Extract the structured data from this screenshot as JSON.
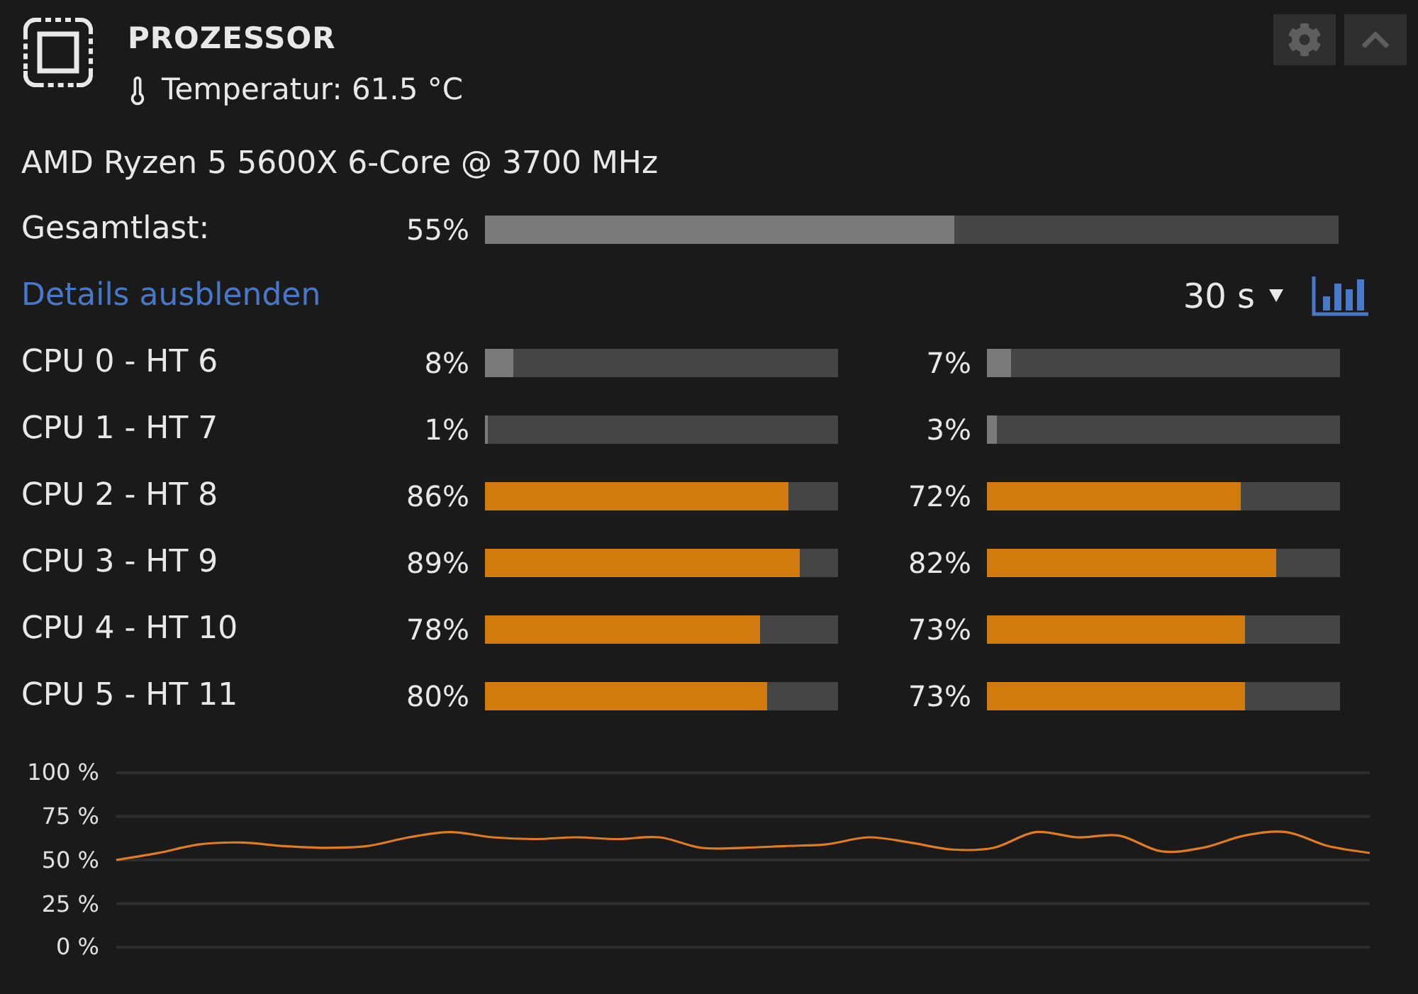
{
  "header": {
    "title": "PROZESSOR",
    "temperature": "Temperatur: 61.5 °C"
  },
  "cpu_name": "AMD Ryzen 5 5600X 6-Core @ 3700 MHz",
  "total_load": {
    "label": "Gesamtlast:",
    "reading": "55%",
    "level": 0.55,
    "color": "#7a7a7a"
  },
  "details_link": "Details ausblenden",
  "interval": {
    "value": "30 s"
  },
  "cores": [
    {
      "label": "CPU 0 - HT 6",
      "threads": [
        {
          "reading": "8%",
          "level": 0.08,
          "color": "#7a7a7a"
        },
        {
          "reading": "7%",
          "level": 0.07,
          "color": "#7a7a7a"
        }
      ]
    },
    {
      "label": "CPU 1 - HT 7",
      "threads": [
        {
          "reading": "1%",
          "level": 0.01,
          "color": "#7a7a7a"
        },
        {
          "reading": "3%",
          "level": 0.03,
          "color": "#7a7a7a"
        }
      ]
    },
    {
      "label": "CPU 2 - HT 8",
      "threads": [
        {
          "reading": "86%",
          "level": 0.86,
          "color": "#d17b0f"
        },
        {
          "reading": "72%",
          "level": 0.72,
          "color": "#d17b0f"
        }
      ]
    },
    {
      "label": "CPU 3 - HT 9",
      "threads": [
        {
          "reading": "89%",
          "level": 0.89,
          "color": "#d17b0f"
        },
        {
          "reading": "82%",
          "level": 0.82,
          "color": "#d17b0f"
        }
      ]
    },
    {
      "label": "CPU 4 - HT 10",
      "threads": [
        {
          "reading": "78%",
          "level": 0.78,
          "color": "#d17b0f"
        },
        {
          "reading": "73%",
          "level": 0.73,
          "color": "#d17b0f"
        }
      ]
    },
    {
      "label": "CPU 5 - HT 11",
      "threads": [
        {
          "reading": "80%",
          "level": 0.8,
          "color": "#d17b0f"
        },
        {
          "reading": "73%",
          "level": 0.73,
          "color": "#d17b0f"
        }
      ]
    }
  ],
  "history": {
    "chart_data": [
      {
        "type": "line",
        "ylim": [
          0,
          100
        ],
        "yticks": [
          {
            "value": 100,
            "label": "100 %"
          },
          {
            "value": 75,
            "label": "75 %"
          },
          {
            "value": 50,
            "label": "50 %"
          },
          {
            "value": 25,
            "label": "25 %"
          },
          {
            "value": 0,
            "label": "0 %"
          }
        ],
        "grid": true,
        "color": "#e07b1f",
        "values": [
          50,
          54,
          59,
          60,
          58,
          57,
          58,
          63,
          66,
          63,
          62,
          63,
          62,
          63,
          57,
          57,
          58,
          59,
          63,
          60,
          56,
          57,
          66,
          63,
          64,
          55,
          57,
          64,
          66,
          58,
          54
        ]
      }
    ]
  }
}
